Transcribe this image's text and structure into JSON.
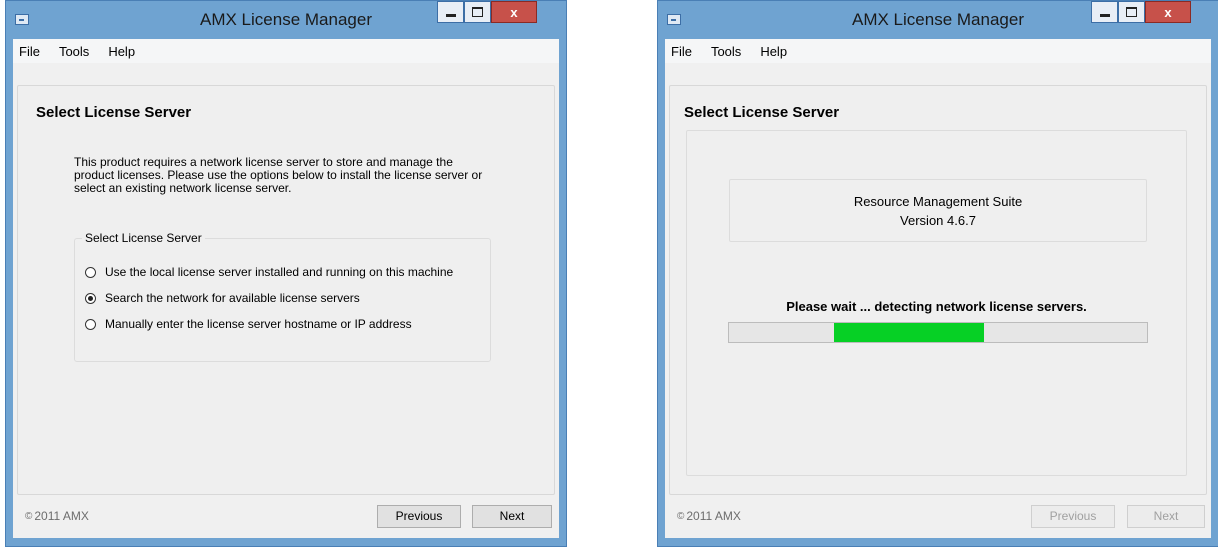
{
  "window_title": "AMX License Manager",
  "menu": [
    "File",
    "Tools",
    "Help"
  ],
  "copyright": "2011 AMX",
  "left": {
    "heading": "Select License Server",
    "description": "This product requires a network license server to store and manage the product licenses.  Please use the options below to install the license server or select an existing network license server.",
    "group_title": "Select License Server",
    "options": [
      {
        "label": "Use the local license server installed and running on this machine",
        "checked": false
      },
      {
        "label": "Search the network for available license servers",
        "checked": true
      },
      {
        "label": "Manually enter the license server hostname or IP address",
        "checked": false
      }
    ],
    "previous_label": "Previous",
    "next_label": "Next"
  },
  "right": {
    "heading": "Select License Server",
    "product_name": "Resource Management Suite",
    "product_version": "Version 4.6.7",
    "wait_message": "Please wait ... detecting network license servers.",
    "progress": {
      "start": 0.25,
      "end": 0.61
    },
    "previous_label": "Previous",
    "next_label": "Next",
    "buttons_disabled": true
  },
  "colors": {
    "progress": "#06d025",
    "titlebar": "#6fa3d1",
    "close": "#c7514a"
  }
}
